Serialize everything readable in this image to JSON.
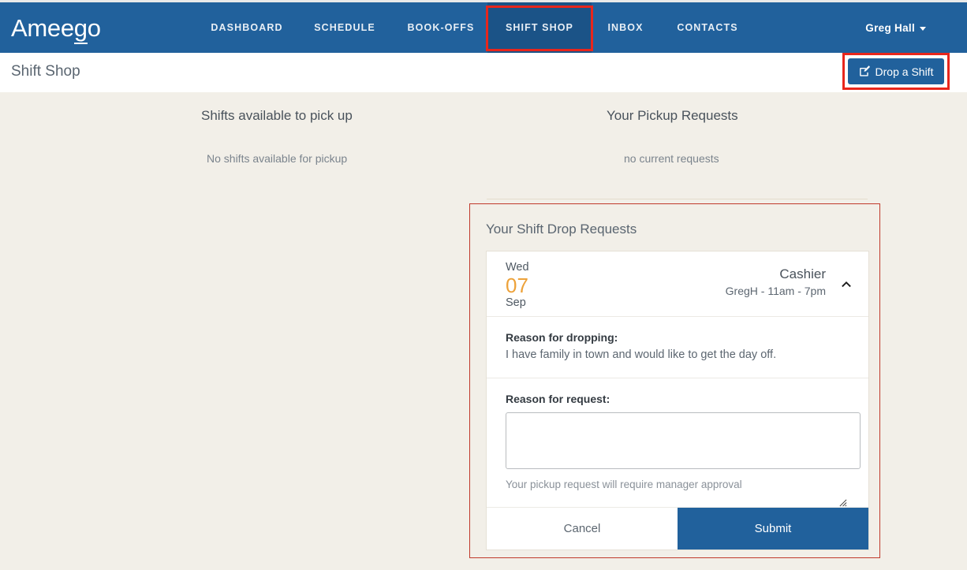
{
  "colors": {
    "nav_blue": "#21619c",
    "nav_active_blue": "#1b5387",
    "page_bg": "#f2efe8",
    "accent_orange": "#eda23a",
    "annotation_red": "#e8261c"
  },
  "topnav": {
    "logo": "Ameego",
    "items": [
      {
        "label": "DASHBOARD",
        "active": false
      },
      {
        "label": "SCHEDULE",
        "active": false
      },
      {
        "label": "BOOK-OFFS",
        "active": false
      },
      {
        "label": "SHIFT SHOP",
        "active": true
      },
      {
        "label": "INBOX",
        "active": false
      },
      {
        "label": "CONTACTS",
        "active": false
      }
    ],
    "user": {
      "name": "Greg Hall",
      "caret_icon": "chevron-down-icon"
    }
  },
  "subheader": {
    "title": "Shift Shop",
    "drop_button": {
      "label": "Drop a Shift",
      "icon": "edit-pencil-square-icon"
    }
  },
  "columns": {
    "available": {
      "heading": "Shifts available to pick up",
      "empty": "No shifts available for pickup"
    },
    "pickup_requests": {
      "heading": "Your Pickup Requests",
      "empty": "no current requests"
    }
  },
  "drop_panel": {
    "title": "Your Shift Drop Requests",
    "shift": {
      "day_of_week": "Wed",
      "day": "07",
      "month": "Sep",
      "role": "Cashier",
      "details": "GregH - 11am - 7pm",
      "collapse_icon": "chevron-up-icon"
    },
    "reason_for_dropping": {
      "label": "Reason for dropping:",
      "text": "I have family in town and would like to get the day off."
    },
    "reason_for_request": {
      "label": "Reason for request:",
      "value": "",
      "placeholder": "",
      "note": "Your pickup request will require manager approval"
    },
    "actions": {
      "cancel": "Cancel",
      "submit": "Submit"
    }
  }
}
